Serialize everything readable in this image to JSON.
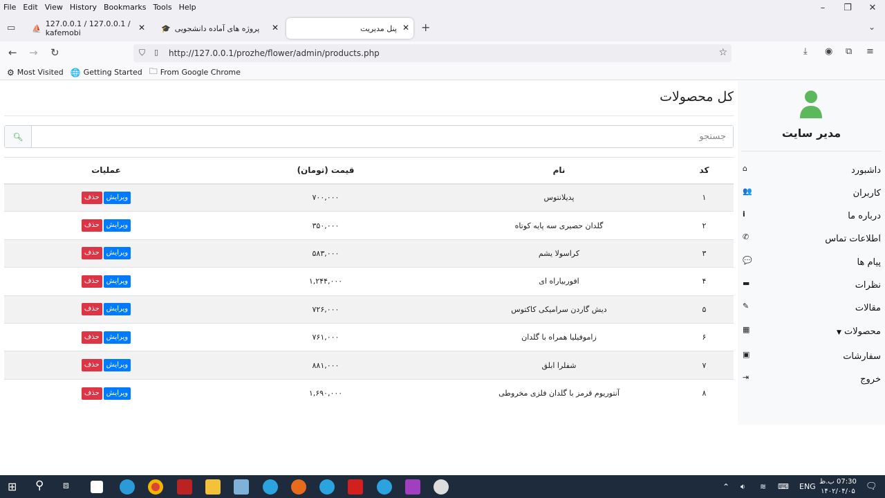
{
  "browser": {
    "menu": [
      "File",
      "Edit",
      "View",
      "History",
      "Bookmarks",
      "Tools",
      "Help"
    ],
    "tabs": [
      {
        "title": "127.0.0.1 / 127.0.0.1 / kafemobi"
      },
      {
        "title": "پروژه های آماده دانشجویی"
      },
      {
        "title": "پنل مدیریت"
      }
    ],
    "url": "http://127.0.0.1/prozhe/flower/admin/products.php",
    "bookmarks": [
      "Most Visited",
      "Getting Started",
      "From Google Chrome"
    ]
  },
  "sidebar": {
    "admin_name": "مدیر سایت",
    "items": [
      {
        "label": "داشبورد",
        "icon": "home-icon"
      },
      {
        "label": "کاربران",
        "icon": "users-icon"
      },
      {
        "label": "درباره ما",
        "icon": "info-icon"
      },
      {
        "label": "اطلاعات تماس",
        "icon": "phone-icon"
      },
      {
        "label": "پیام ها",
        "icon": "comments-icon"
      },
      {
        "label": "نظرات",
        "icon": "ticket-icon"
      },
      {
        "label": "مقالات",
        "icon": "edit-icon"
      },
      {
        "label": "محصولات",
        "icon": "boxes-icon"
      },
      {
        "label": "سفارشات",
        "icon": "image-icon"
      },
      {
        "label": "خروج",
        "icon": "sign-out-icon"
      }
    ]
  },
  "main": {
    "title": "کل محصولات",
    "search_placeholder": "جستجو",
    "columns": {
      "code": "کد",
      "name": "نام",
      "price": "قیمت (تومان)",
      "actions": "عملیات"
    },
    "edit_label": "ویرایش",
    "delete_label": "حذف",
    "rows": [
      {
        "code": "۱",
        "name": "پدیلانتوس",
        "price": "۷۰۰,۰۰۰"
      },
      {
        "code": "۲",
        "name": "گلدان حصیری سه پایه کوتاه",
        "price": "۳۵۰,۰۰۰"
      },
      {
        "code": "۳",
        "name": "کراسولا یشم",
        "price": "۵۸۳,۰۰۰"
      },
      {
        "code": "۴",
        "name": "افوربیاراه ای",
        "price": "۱,۲۴۴,۰۰۰"
      },
      {
        "code": "۵",
        "name": "دیش گاردن سرامیکی کاکتوس",
        "price": "۷۲۶,۰۰۰"
      },
      {
        "code": "۶",
        "name": "زاموفیلیا همراه با گلدان",
        "price": "۷۶۱,۰۰۰"
      },
      {
        "code": "۷",
        "name": "شفلرا ابلق",
        "price": "۸۸۱,۰۰۰"
      },
      {
        "code": "۸",
        "name": "آنتوریوم قرمز با گلدان فلزی مخروطی",
        "price": "۱,۶۹۰,۰۰۰"
      }
    ]
  },
  "taskbar": {
    "lang": "ENG",
    "time": "07:30 ب.ظ",
    "date": "۱۴۰۲/۰۴/۰۵"
  }
}
